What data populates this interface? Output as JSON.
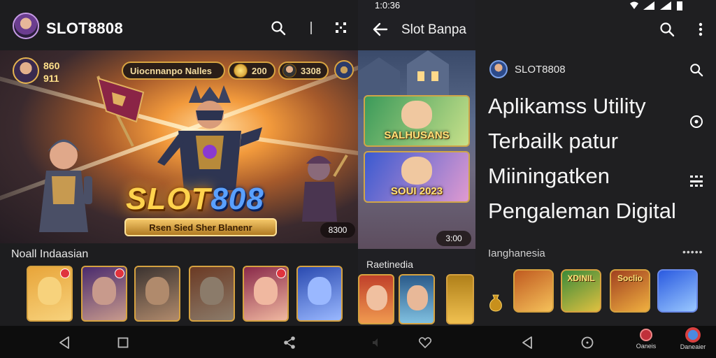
{
  "status_bar": {
    "time": "1:0:36"
  },
  "left_app": {
    "title": "SLOT8808",
    "banner": {
      "stat_top": "860",
      "stat_bottom": "911",
      "title_pill": "Uiocnnanpo Nalles",
      "coins": "200",
      "score": "3308",
      "logo_main": "SLOT",
      "logo_accent": "808",
      "cta": "Rsen Sied Sher Blanenr",
      "badge": "8300"
    },
    "section_label": "Noall Indaasian",
    "thumbnails": [
      {
        "name": "golden-heroine",
        "badge": true,
        "colors": [
          "#e8a53a",
          "#f7d27c"
        ]
      },
      {
        "name": "pirate-captain",
        "badge": true,
        "colors": [
          "#4a2b6e",
          "#c89a8c"
        ]
      },
      {
        "name": "bearded-warrior",
        "badge": false,
        "colors": [
          "#3b3330",
          "#b08a6c"
        ]
      },
      {
        "name": "armored-knight",
        "badge": false,
        "colors": [
          "#6b3a24",
          "#8b7b6a"
        ]
      },
      {
        "name": "red-hat-girl",
        "badge": true,
        "colors": [
          "#8a2a4a",
          "#f0b8a0"
        ]
      },
      {
        "name": "blue-sword-hero",
        "badge": false,
        "colors": [
          "#2a4ab0",
          "#9ab8ff"
        ]
      }
    ]
  },
  "mid_app": {
    "title": "Slot Banpa",
    "cards": [
      {
        "label": "SALHUSANS",
        "colors": [
          "#3b9a5a",
          "#c7e08a"
        ]
      },
      {
        "label": "SOUI 2023",
        "colors": [
          "#3a5ad0",
          "#e09ad0"
        ]
      }
    ],
    "badge": "3:00",
    "section_label": "Raetinedia"
  },
  "right_app": {
    "app_name": "SLOT8808",
    "headline": [
      "Aplikamss Utility",
      "Terbailk patur",
      "Miiningatken",
      "Pengaleman Digital"
    ],
    "section_label": "Ianghanesia",
    "more": "•••••",
    "thumbnails": [
      {
        "name": "flame-sword-tile",
        "label": "",
        "colors": [
          "#c05a20",
          "#f5c15a"
        ]
      },
      {
        "name": "xdinil-tile",
        "label": "XDINIL",
        "colors": [
          "#3a8a3a",
          "#e0c040"
        ]
      },
      {
        "name": "soclio-tile",
        "label": "Soclio",
        "colors": [
          "#a04020",
          "#f0b040"
        ]
      },
      {
        "name": "blue-mascot-tile",
        "label": "",
        "colors": [
          "#2a5ae0",
          "#9ac8ff"
        ]
      }
    ],
    "nav_labels": [
      "Oaneis",
      "Daneaier"
    ]
  }
}
